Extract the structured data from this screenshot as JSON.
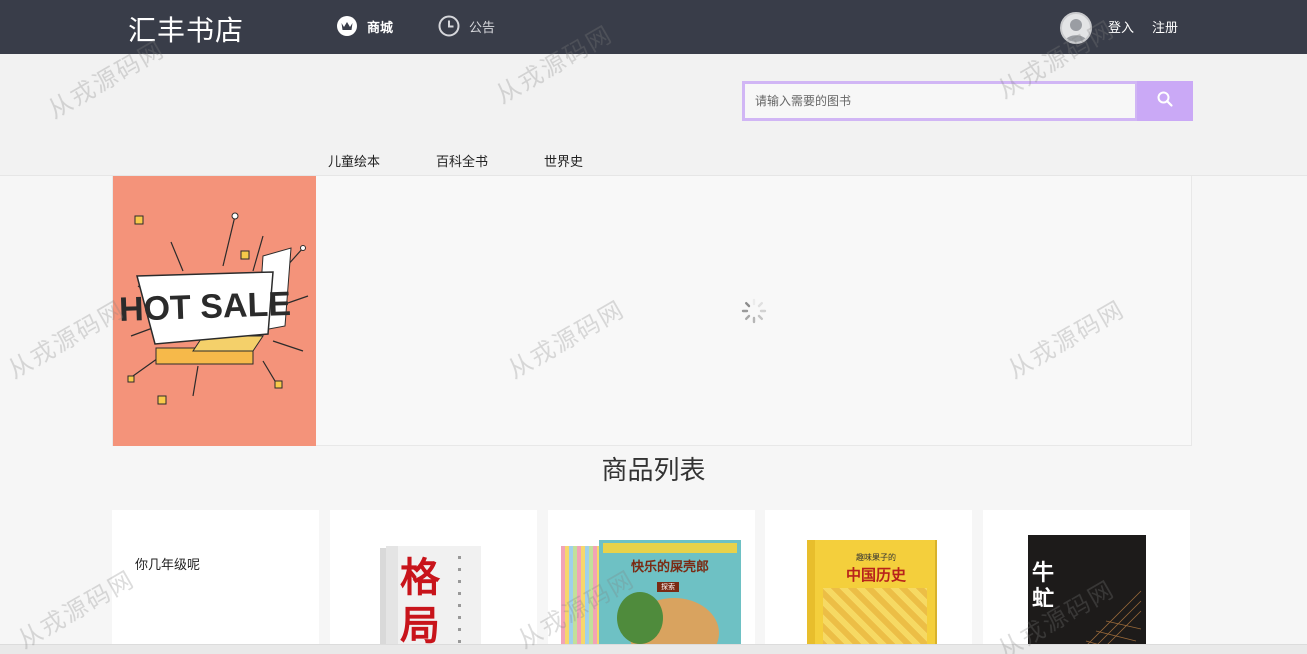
{
  "header": {
    "logo": "汇丰书店",
    "nav": [
      {
        "label": "商城",
        "icon": "crown-icon"
      },
      {
        "label": "公告",
        "icon": "clock-icon"
      }
    ],
    "login": "登入",
    "register": "注册"
  },
  "search": {
    "placeholder": "请输入需要的图书"
  },
  "categories": [
    "儿童绘本",
    "百科全书",
    "世界史"
  ],
  "banner": {
    "text": "HOT SALE"
  },
  "section_title": "商品列表",
  "products": [
    {
      "text": "你几年级呢"
    },
    {
      "title": "格局"
    },
    {
      "title": "快乐的屎壳郎",
      "badge": "探索"
    },
    {
      "title": "中国历史",
      "subtitle": "趣味果子的"
    },
    {
      "title": "牛虻"
    }
  ],
  "watermark": "从戎源码网",
  "colors": {
    "topbar": "#393d49",
    "accent": "#caa9f6",
    "hot_sale_bg": "#f4937a"
  }
}
